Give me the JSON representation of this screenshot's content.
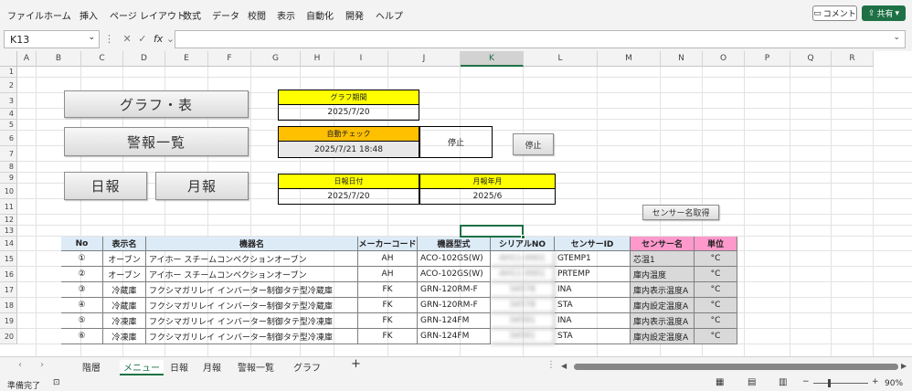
{
  "ribbon": {
    "tabs": [
      "ファイル",
      "ホーム",
      "挿入",
      "ページ レイアウト",
      "数式",
      "データ",
      "校閲",
      "表示",
      "自動化",
      "開発",
      "ヘルプ"
    ],
    "comment_label": "コメント",
    "share_label": "共有"
  },
  "formula_bar": {
    "name_box": "K13",
    "fx": "fx",
    "value": ""
  },
  "columns": [
    "A",
    "B",
    "C",
    "D",
    "E",
    "F",
    "G",
    "H",
    "I",
    "J",
    "K",
    "L",
    "M",
    "N",
    "O",
    "P",
    "Q",
    "R"
  ],
  "selected_column": "K",
  "rows": [
    "1",
    "2",
    "3",
    "4",
    "5",
    "6",
    "7",
    "8",
    "9",
    "10",
    "11",
    "12",
    "13",
    "14",
    "15",
    "16",
    "17",
    "18",
    "19",
    "20"
  ],
  "sheet": {
    "btn_graph": "グラフ・表",
    "btn_alerts": "警報一覧",
    "btn_daily": "日報",
    "btn_monthly": "月報",
    "graph_period_label": "グラフ期間",
    "graph_period_value": "2025/7/20",
    "auto_check_label": "自動チェック",
    "auto_check_value": "2025/7/21 18:48",
    "auto_check_status": "停止",
    "btn_stop": "停止",
    "daily_date_label": "日報日付",
    "daily_date_value": "2025/7/20",
    "monthly_label": "月報年月",
    "monthly_value": "2025/6",
    "btn_sensor_fetch": "センサー名取得"
  },
  "table": {
    "headers": [
      "No",
      "表示名",
      "機器名",
      "メーカーコード",
      "機器型式",
      "シリアルNO",
      "センサーID",
      "センサー名",
      "単位"
    ],
    "rows": [
      {
        "no": "①",
        "display": "オーブン",
        "device": "アイホー スチームコンベクションオーブン",
        "maker": "AH",
        "model": "ACO-102GS(W)",
        "serial": "AH11-0001",
        "sensor_id": "GTEMP1",
        "sensor_name": "芯温1",
        "unit": "°C"
      },
      {
        "no": "②",
        "display": "オーブン",
        "device": "アイホー スチームコンベクションオーブン",
        "maker": "AH",
        "model": "ACO-102GS(W)",
        "serial": "AH11-0001",
        "sensor_id": "PRTEMP",
        "sensor_name": "庫内温度",
        "unit": "°C"
      },
      {
        "no": "③",
        "display": "冷蔵庫",
        "device": "フクシマガリレイ インバーター制御タテ型冷蔵庫",
        "maker": "FK",
        "model": "GRN-120RM-F",
        "serial": "34578",
        "sensor_id": "INA",
        "sensor_name": "庫内表示温度A",
        "unit": "°C"
      },
      {
        "no": "④",
        "display": "冷蔵庫",
        "device": "フクシマガリレイ インバーター制御タテ型冷蔵庫",
        "maker": "FK",
        "model": "GRN-120RM-F",
        "serial": "34578",
        "sensor_id": "STA",
        "sensor_name": "庫内設定温度A",
        "unit": "°C"
      },
      {
        "no": "⑤",
        "display": "冷凍庫",
        "device": "フクシマガリレイ インバーター制御タテ型冷凍庫",
        "maker": "FK",
        "model": "GRN-124FM",
        "serial": "34591",
        "sensor_id": "INA",
        "sensor_name": "庫内表示温度A",
        "unit": "°C"
      },
      {
        "no": "⑥",
        "display": "冷凍庫",
        "device": "フクシマガリレイ インバーター制御タテ型冷凍庫",
        "maker": "FK",
        "model": "GRN-124FM",
        "serial": "34591",
        "sensor_id": "STA",
        "sensor_name": "庫内設定温度A",
        "unit": "°C"
      }
    ]
  },
  "tabs": [
    "階層",
    "メニュー",
    "日報",
    "月報",
    "警報一覧",
    "グラフ"
  ],
  "active_tab": "メニュー",
  "status": {
    "ready": "準備完了",
    "zoom": "90%"
  },
  "colors": {
    "accent": "#1e7145",
    "yellow": "#ffff00",
    "orange": "#ffc000",
    "header_blue": "#ddebf7",
    "header_pink": "#ff99cc"
  }
}
